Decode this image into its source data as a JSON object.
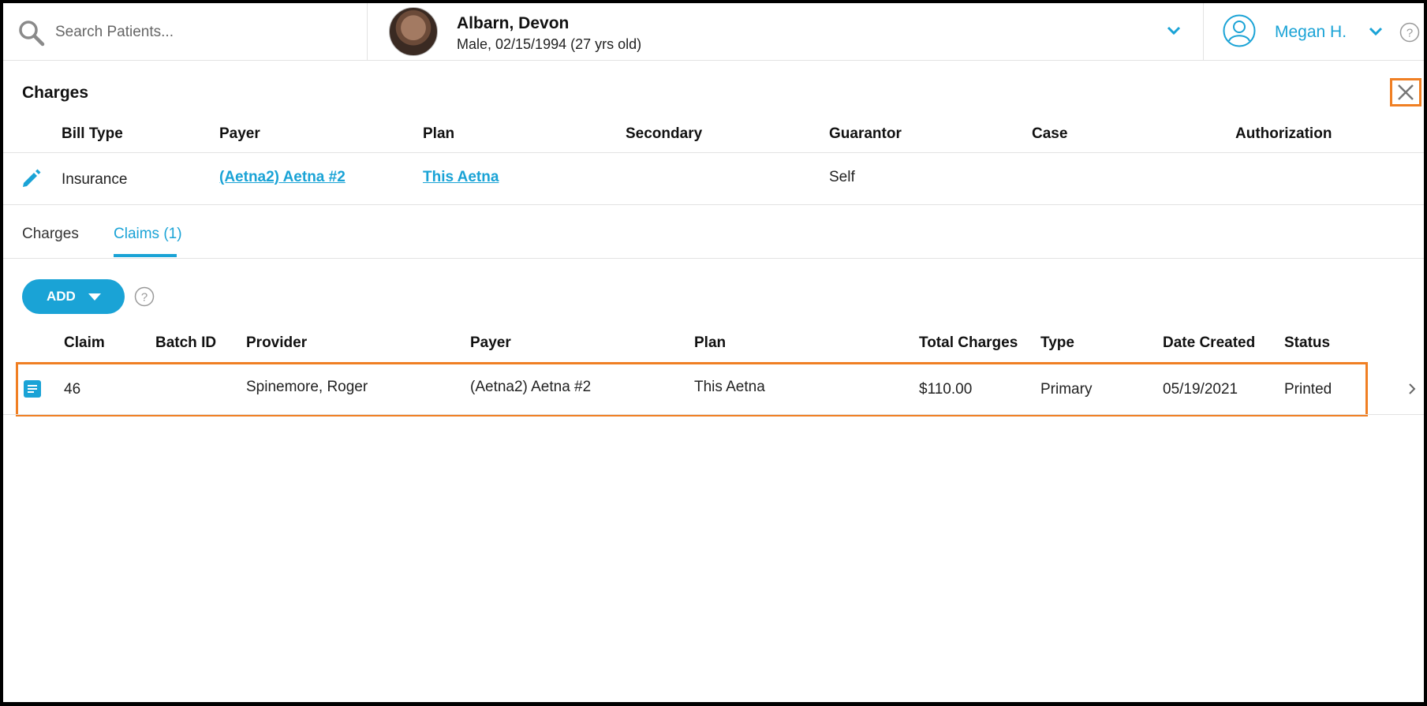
{
  "search": {
    "placeholder": "Search Patients..."
  },
  "patient": {
    "name": "Albarn, Devon",
    "info": "Male, 02/15/1994 (27 yrs old)"
  },
  "user": {
    "name": "Megan H."
  },
  "panel": {
    "title": "Charges",
    "columns": [
      "Bill Type",
      "Payer",
      "Plan",
      "Secondary",
      "Guarantor",
      "Case",
      "Authorization"
    ],
    "row": {
      "bill_type": "Insurance",
      "payer": "(Aetna2) Aetna #2",
      "plan": "This Aetna",
      "secondary": "",
      "guarantor": "Self",
      "case": "",
      "authorization": ""
    }
  },
  "tabs": [
    {
      "label": "Charges",
      "active": false
    },
    {
      "label": "Claims (1)",
      "active": true
    }
  ],
  "add_button": {
    "label": "ADD"
  },
  "claims": {
    "columns": [
      "Claim",
      "Batch ID",
      "Provider",
      "Payer",
      "Plan",
      "Total Charges",
      "Type",
      "Date Created",
      "Status"
    ],
    "rows": [
      {
        "claim": "46",
        "batch_id": "",
        "provider": "Spinemore, Roger",
        "payer": "(Aetna2) Aetna #2",
        "plan": "This Aetna",
        "total_charges": "$110.00",
        "type": "Primary",
        "date_created": "05/19/2021",
        "status": "Printed"
      }
    ]
  },
  "colors": {
    "accent": "#1aa3d6",
    "highlight": "#f07f23"
  }
}
